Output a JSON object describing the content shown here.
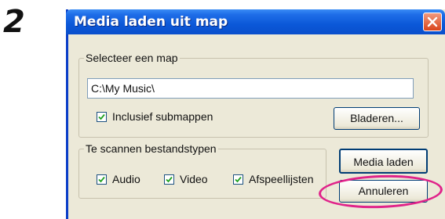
{
  "step_number": "2",
  "window": {
    "title": "Media laden uit map"
  },
  "folder_group": {
    "legend": "Selecteer een map",
    "path_value": "C:\\My Music\\",
    "include_subfolders_label": "Inclusief submappen",
    "include_subfolders_checked": true,
    "browse_label": "Bladeren..."
  },
  "filetypes_group": {
    "legend": "Te scannen bestandstypen",
    "options": [
      {
        "label": "Audio",
        "checked": true
      },
      {
        "label": "Video",
        "checked": true
      },
      {
        "label": "Afspeellijsten",
        "checked": true
      }
    ]
  },
  "buttons": {
    "load_media": "Media laden",
    "cancel": "Annuleren"
  },
  "colors": {
    "titlebar": "#0b58d8",
    "dialog_bg": "#ece9d8",
    "highlight": "#e0238a"
  }
}
